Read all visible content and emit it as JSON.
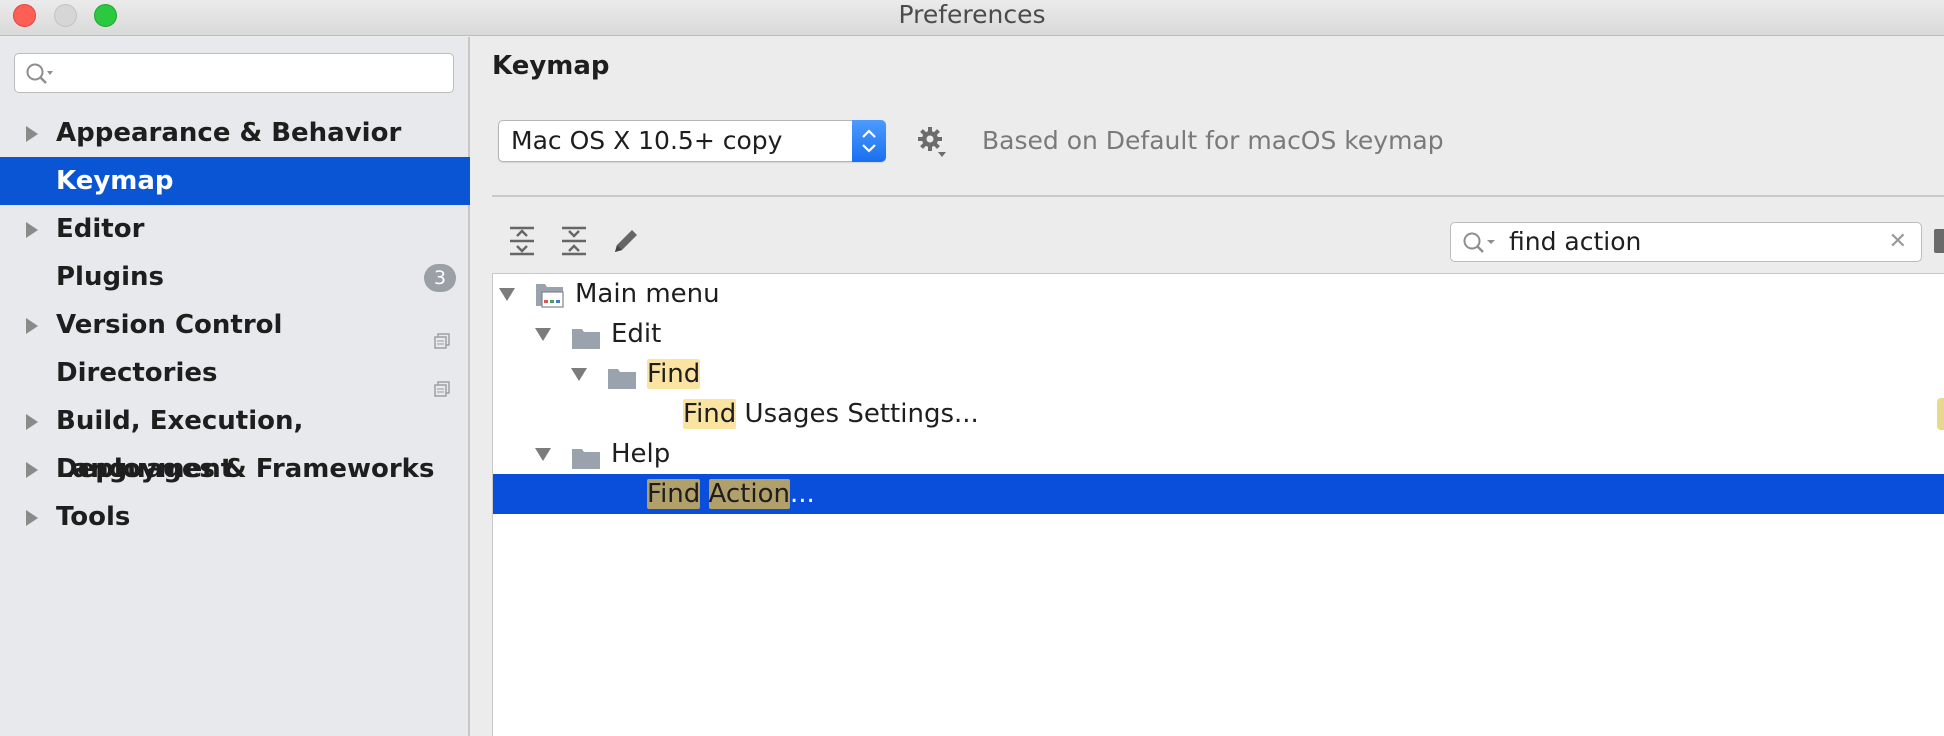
{
  "window": {
    "title": "Preferences"
  },
  "sidebar": {
    "search_placeholder": "",
    "items": [
      {
        "label": "Appearance & Behavior",
        "expandable": true
      },
      {
        "label": "Keymap",
        "selected": true
      },
      {
        "label": "Editor",
        "expandable": true
      },
      {
        "label": "Plugins",
        "badge": "3"
      },
      {
        "label": "Version Control",
        "expandable": true
      },
      {
        "label": "Directories"
      },
      {
        "label": "Build, Execution, Deployment",
        "expandable": true
      },
      {
        "label": "Languages & Frameworks",
        "expandable": true
      },
      {
        "label": "Tools",
        "expandable": true
      }
    ]
  },
  "main": {
    "title": "Keymap",
    "keymap_select": "Mac OS X 10.5+ copy",
    "based_on": "Based on Default for macOS keymap",
    "filter": {
      "value": "find action",
      "clear": "✕"
    },
    "tree": {
      "main_menu": "Main menu",
      "edit": "Edit",
      "find_folder": "Find",
      "find_usages_hl": "Find",
      "find_usages_rest": " Usages Settings...",
      "find_usages_shortcut": "⌥",
      "help": "Help",
      "find_action_hl1": "Find",
      "find_action_hl2": "Action",
      "find_action_rest": "..."
    }
  },
  "colors": {
    "accent": "#0a55d4",
    "highlight": "#fbe3a1"
  }
}
